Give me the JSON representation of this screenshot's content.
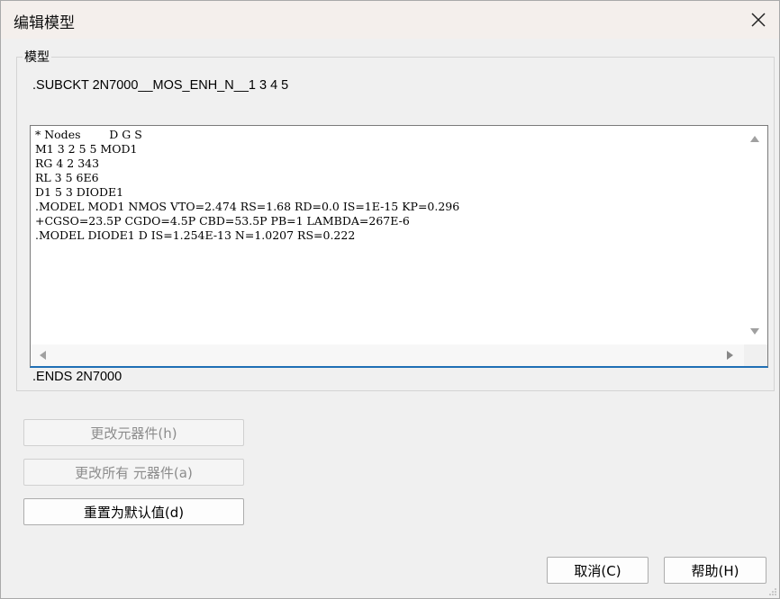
{
  "window": {
    "title": "编辑模型"
  },
  "model_group": {
    "label": "模型",
    "subckt_line": ".SUBCKT 2N7000__MOS_ENH_N__1 3 4 5",
    "code_lines": [
      "* Nodes        D G S",
      "M1 3 2 5 5 MOD1",
      "RG 4 2 343",
      "RL 3 5 6E6",
      "D1 5 3 DIODE1",
      ".MODEL MOD1 NMOS VTO=2.474 RS=1.68 RD=0.0 IS=1E-15 KP=0.296",
      "+CGSO=23.5P CGDO=4.5P CBD=53.5P PB=1 LAMBDA=267E-6",
      ".MODEL DIODE1 D IS=1.254E-13 N=1.0207 RS=0.222"
    ],
    "ends_line": ".ENDS 2N7000"
  },
  "buttons": {
    "change_part": "更改元器件(h)",
    "change_all_parts": "更改所有 元器件(a)",
    "reset_default": "重置为默认值(d)",
    "cancel": "取消(C)",
    "help": "帮助(H)"
  },
  "icons": {
    "close": "close-icon",
    "scroll_up": "scroll-up-arrow-icon",
    "scroll_down": "scroll-down-arrow-icon",
    "scroll_left": "scroll-left-arrow-icon",
    "scroll_right": "scroll-right-arrow-icon"
  }
}
